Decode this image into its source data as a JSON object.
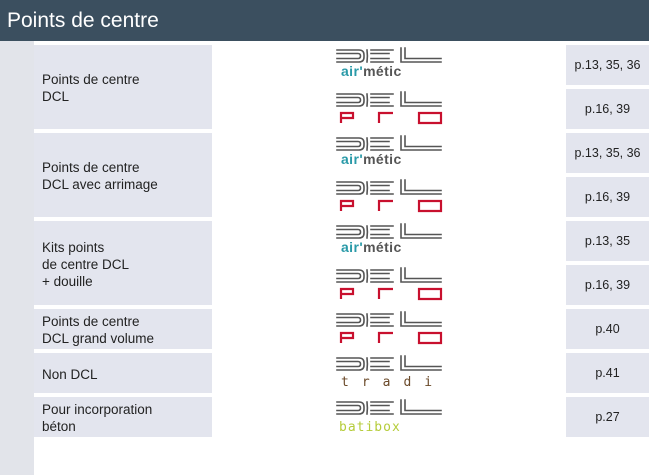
{
  "header": {
    "title": "Points de centre"
  },
  "groups": [
    {
      "label_lines": [
        "Points de centre",
        "DCL"
      ],
      "rows": [
        {
          "logo": "air-metic",
          "logo_text": "air'métic",
          "page": "p.13, 35, 36"
        },
        {
          "logo": "pro",
          "logo_text": "pro",
          "page": "p.16, 39"
        }
      ]
    },
    {
      "label_lines": [
        "Points de centre",
        "DCL avec arrimage"
      ],
      "rows": [
        {
          "logo": "air-metic",
          "logo_text": "air'métic",
          "page": "p.13, 35, 36"
        },
        {
          "logo": "pro",
          "logo_text": "pro",
          "page": "p.16, 39"
        }
      ]
    },
    {
      "label_lines": [
        "Kits points",
        "de centre DCL",
        "+ douille"
      ],
      "rows": [
        {
          "logo": "air-metic",
          "logo_text": "air'métic",
          "page": "p.13, 35"
        },
        {
          "logo": "pro",
          "logo_text": "pro",
          "page": "p.16, 39"
        }
      ]
    },
    {
      "label_lines": [
        "Points de centre",
        "DCL grand volume"
      ],
      "rows": [
        {
          "logo": "pro",
          "logo_text": "pro",
          "page": "p.40"
        }
      ]
    },
    {
      "label_lines": [
        "Non DCL"
      ],
      "rows": [
        {
          "logo": "tradi",
          "logo_text": "tradi",
          "page": "p.41"
        }
      ]
    },
    {
      "label_lines": [
        "Pour incorporation",
        "béton"
      ],
      "rows": [
        {
          "logo": "batibox",
          "logo_text": "batibox",
          "page": "p.27"
        }
      ]
    }
  ],
  "colors": {
    "header_bg": "#3b4f5f",
    "cell_bg": "#e3e5ee",
    "dcl_grey": "#555555",
    "air_teal": "#2a9aa8",
    "metic_grey": "#555555",
    "pro_red": "#c8102e",
    "tradi_brown": "#6b4a2a",
    "batibox_green": "#b5cc3a"
  }
}
